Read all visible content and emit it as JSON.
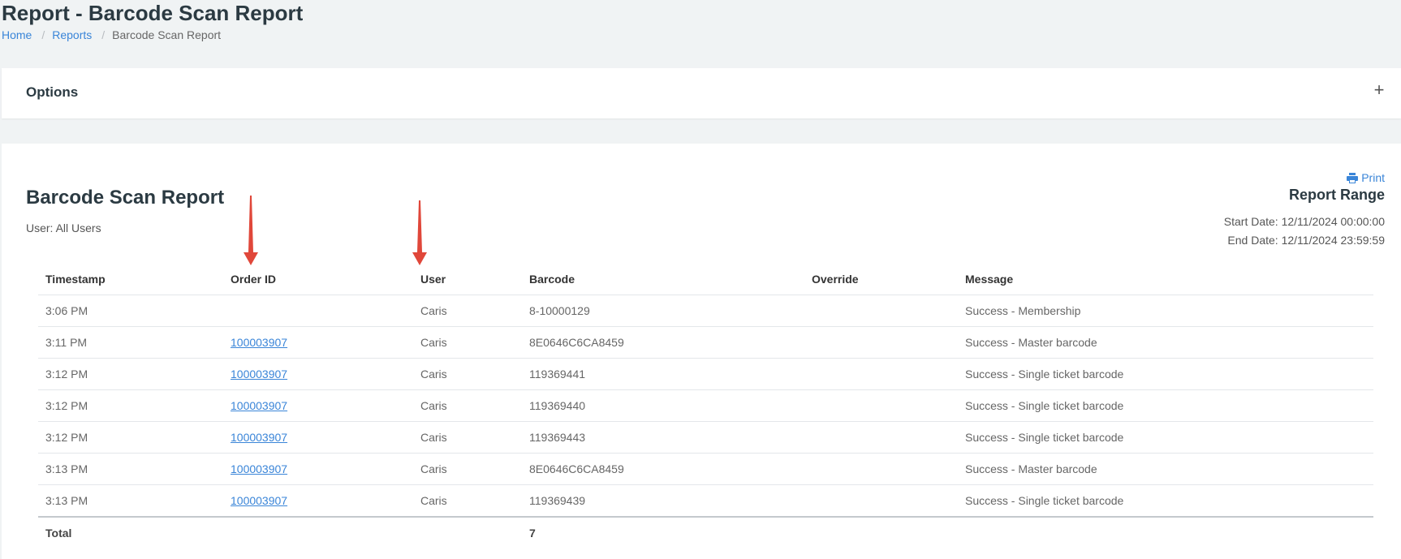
{
  "page": {
    "title": "Report - Barcode Scan Report",
    "breadcrumb": [
      "Home",
      "Reports",
      "Barcode Scan Report"
    ]
  },
  "options": {
    "title": "Options",
    "toggle_icon": "+"
  },
  "report": {
    "title": "Barcode Scan Report",
    "user_filter": "User: All Users",
    "print_label": "Print",
    "range_title": "Report Range",
    "start_date": "Start Date: 12/11/2024 00:00:00",
    "end_date": "End Date: 12/11/2024 23:59:59"
  },
  "table": {
    "headers": [
      "Timestamp",
      "Order ID",
      "User",
      "Barcode",
      "Override",
      "Message"
    ],
    "rows": [
      {
        "timestamp": "3:06 PM",
        "order_id": "",
        "user": "Caris",
        "barcode": "8-10000129",
        "override": "",
        "message": "Success - Membership"
      },
      {
        "timestamp": "3:11 PM",
        "order_id": "100003907",
        "user": "Caris",
        "barcode": "8E0646C6CA8459",
        "override": "",
        "message": "Success - Master barcode"
      },
      {
        "timestamp": "3:12 PM",
        "order_id": "100003907",
        "user": "Caris",
        "barcode": "119369441",
        "override": "",
        "message": "Success - Single ticket barcode"
      },
      {
        "timestamp": "3:12 PM",
        "order_id": "100003907",
        "user": "Caris",
        "barcode": "119369440",
        "override": "",
        "message": "Success - Single ticket barcode"
      },
      {
        "timestamp": "3:12 PM",
        "order_id": "100003907",
        "user": "Caris",
        "barcode": "119369443",
        "override": "",
        "message": "Success - Single ticket barcode"
      },
      {
        "timestamp": "3:13 PM",
        "order_id": "100003907",
        "user": "Caris",
        "barcode": "8E0646C6CA8459",
        "override": "",
        "message": "Success - Master barcode"
      },
      {
        "timestamp": "3:13 PM",
        "order_id": "100003907",
        "user": "Caris",
        "barcode": "119369439",
        "override": "",
        "message": "Success - Single ticket barcode"
      }
    ],
    "total_label": "Total",
    "total_count": "7"
  },
  "colors": {
    "link": "#3a85d8",
    "annotation_arrow": "#e0473a"
  }
}
